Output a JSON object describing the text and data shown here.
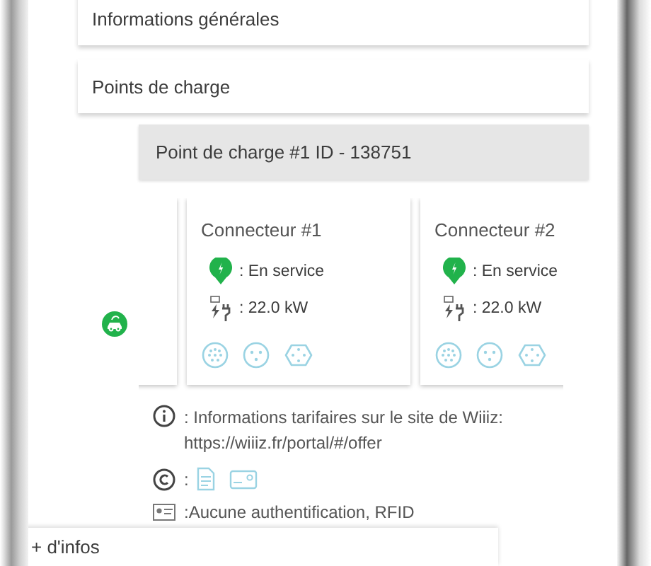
{
  "sections": [
    {
      "title": "Informations générales"
    },
    {
      "title": "Points de charge"
    }
  ],
  "charge_point": {
    "title": "Point de charge #1 ID - 138751",
    "connectors": [
      {
        "title": "Connecteur #1",
        "status": ": En service",
        "power": ": 22.0 kW"
      },
      {
        "title": "Connecteur #2",
        "status": ": En service",
        "power": ": 22.0 kW"
      }
    ]
  },
  "info": {
    "tariff": ": Informations tarifaires sur le site de Wiiiz: https://wiiiz.fr/portal/#/offer",
    "payment": ":",
    "auth": ":Aucune authentification, RFID"
  },
  "more": "+ d'infos"
}
